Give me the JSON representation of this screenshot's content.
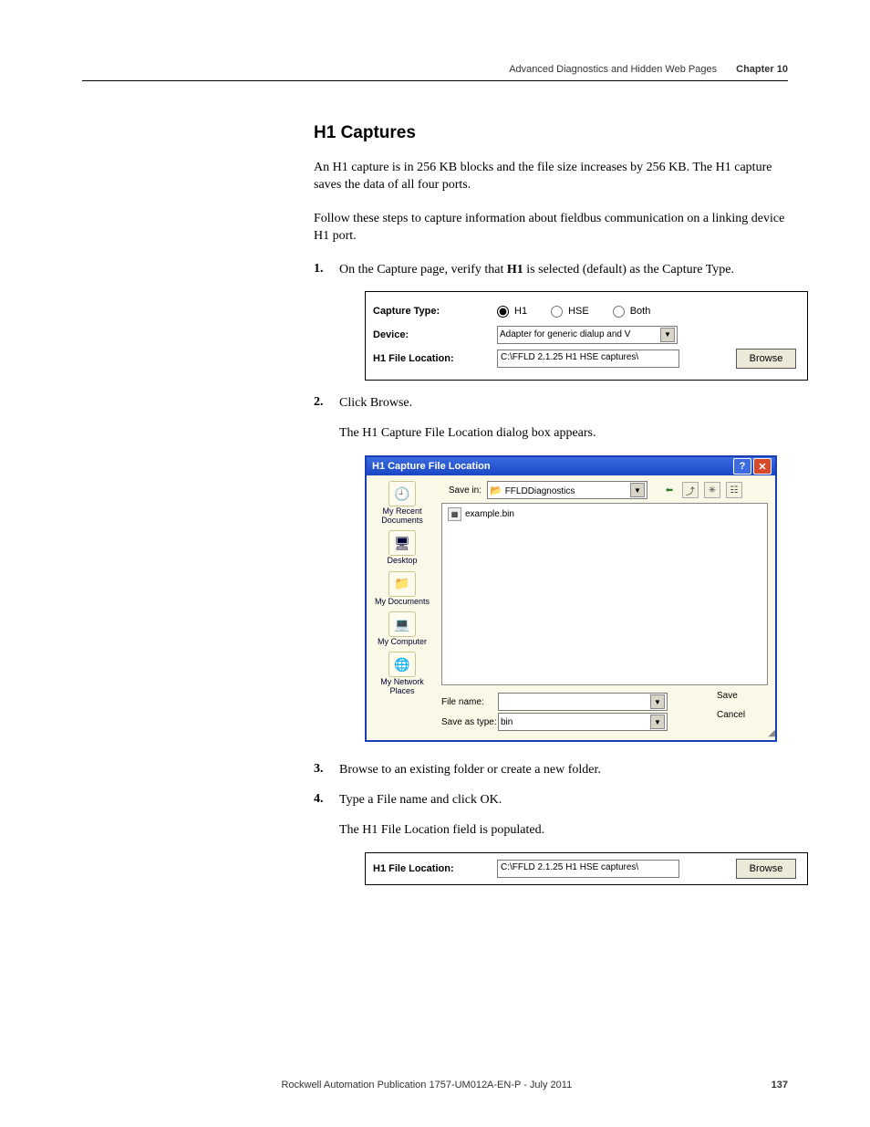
{
  "header": {
    "running_title": "Advanced Diagnostics and Hidden Web Pages",
    "chapter": "Chapter 10"
  },
  "section_title": "H1 Captures",
  "para1": "An H1 capture is in 256 KB blocks and the file size increases by 256 KB. The H1 capture saves the data of all four ports.",
  "para2": "Follow these steps to capture information about fieldbus communication on a linking device H1 port.",
  "step1_a": "On the Capture page, verify that ",
  "step1_b": "H1",
  "step1_c": " is selected (default) as the Capture Type.",
  "panel1": {
    "capture_type_label": "Capture Type:",
    "radio_h1": "H1",
    "radio_hse": "HSE",
    "radio_both": "Both",
    "device_label": "Device:",
    "device_value": "Adapter for generic dialup and V",
    "h1file_label": "H1 File Location:",
    "h1file_value": "C:\\FFLD 2.1.25 H1 HSE captures\\",
    "browse": "Browse"
  },
  "step2": "Click Browse.",
  "step2_note": "The H1 Capture File Location dialog box appears.",
  "dialog": {
    "title": "H1 Capture File Location",
    "savein_label": "Save in:",
    "savein_value": "FFLDDiagnostics",
    "file_entry": "example.bin",
    "places": {
      "recent": "My Recent Documents",
      "desktop": "Desktop",
      "mydocs": "My Documents",
      "mycomp": "My Computer",
      "mynet": "My Network Places"
    },
    "filename_label": "File name:",
    "filename_value": "",
    "saveas_label": "Save as type:",
    "saveas_value": "bin",
    "save_btn": "Save",
    "cancel_btn": "Cancel"
  },
  "step3": "Browse to an existing folder or create a new folder.",
  "step4": "Type a File name and click OK.",
  "step4_note": "The H1 File Location field is populated.",
  "panel2": {
    "label": "H1 File Location:",
    "value": "C:\\FFLD 2.1.25 H1 HSE captures\\",
    "browse": "Browse"
  },
  "footer": {
    "pub": "Rockwell Automation Publication 1757-UM012A-EN-P - July 2011",
    "page": "137"
  }
}
